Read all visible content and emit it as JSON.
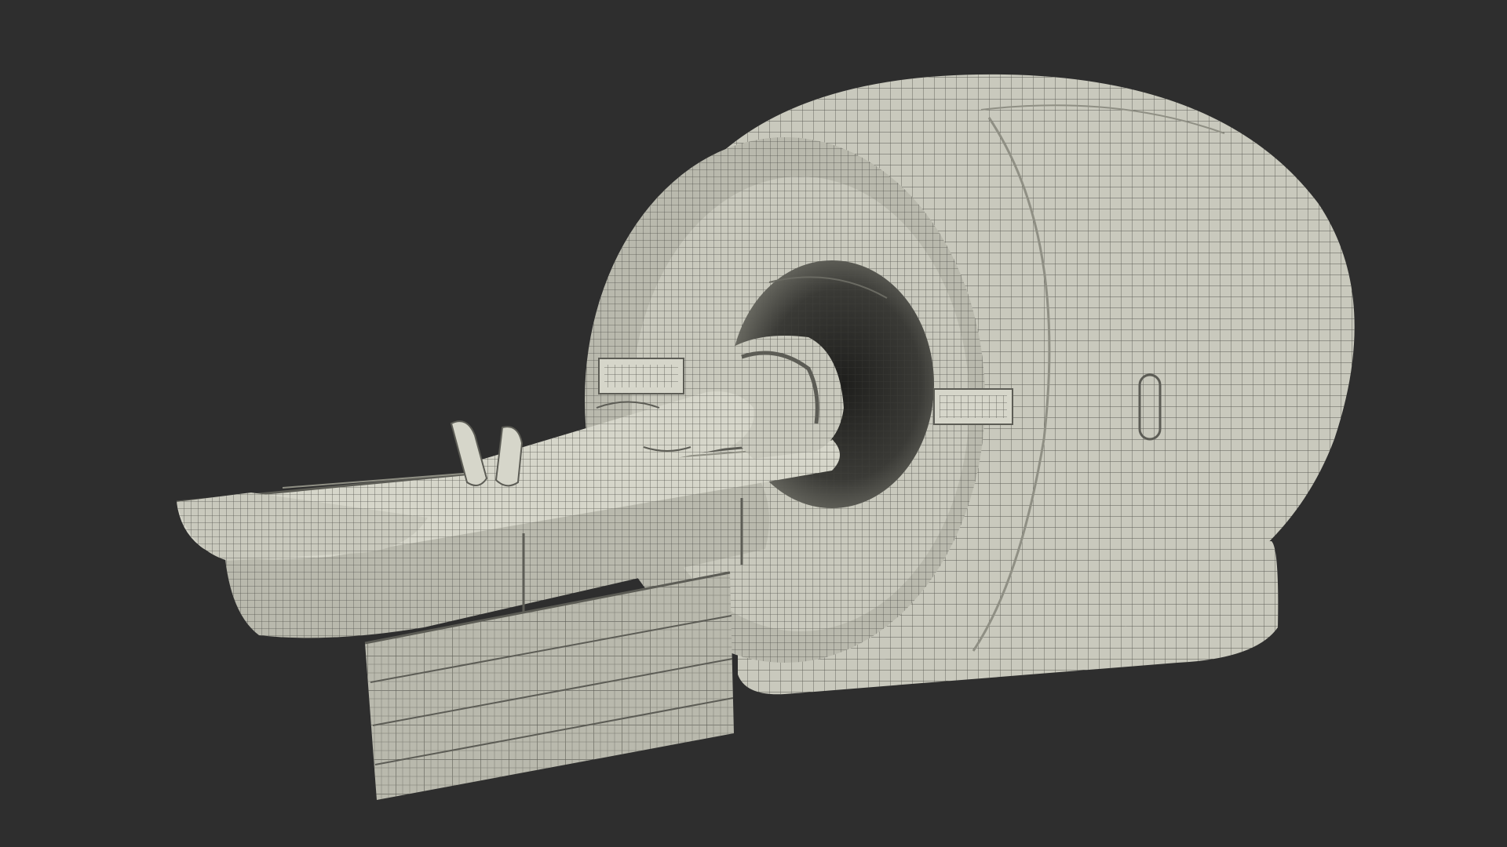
{
  "scene": {
    "background_color": "#2e2e2e",
    "model_color": "#c9c9bd",
    "model_shade_color": "#a9a99d",
    "model_dark_color": "#8f8f84",
    "wire_color": "#5c5c55",
    "render_style": "wireframe-over-clay",
    "subject": "mri-scanner-with-patient"
  }
}
